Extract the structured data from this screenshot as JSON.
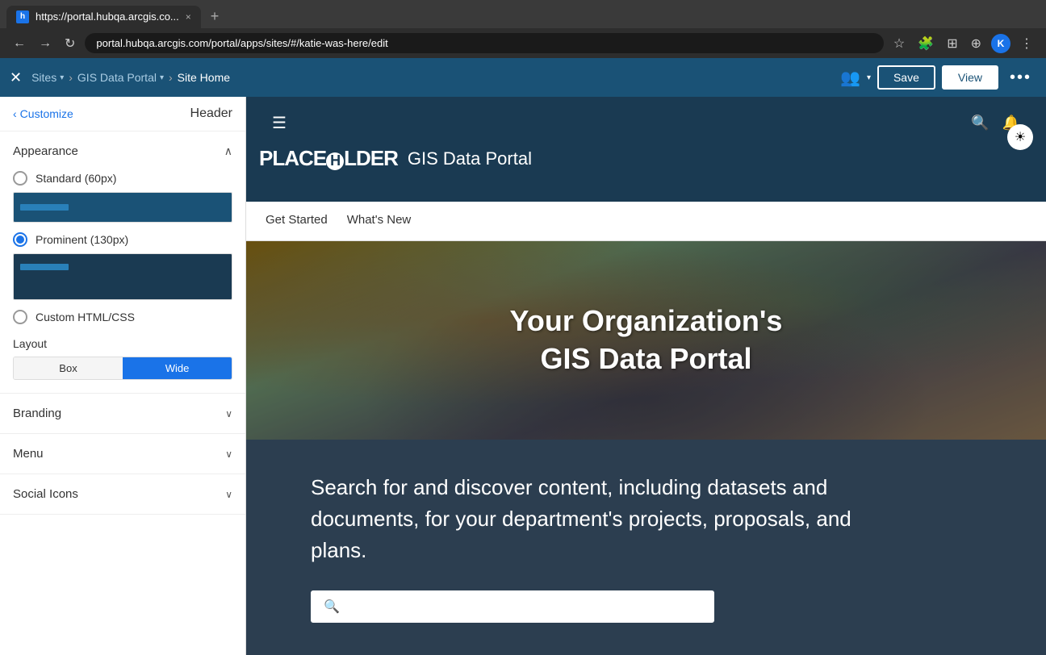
{
  "browser": {
    "tab_title": "https://portal.hubqa.arcgis.co...",
    "address": "portal.hubqa.arcgis.com/portal/apps/sites/#/katie-was-here/edit",
    "tab_close": "×",
    "tab_new": "+",
    "nav_back": "←",
    "nav_forward": "→",
    "nav_refresh": "↻",
    "profile_initial": "K"
  },
  "app_header": {
    "close_icon": "✕",
    "sites_label": "Sites",
    "gis_portal_label": "GIS Data Portal",
    "site_home_label": "Site Home",
    "save_label": "Save",
    "view_label": "View",
    "more_icon": "•••"
  },
  "panel": {
    "back_label": "Customize",
    "title": "Header",
    "appearance_title": "Appearance",
    "collapse_icon": "∧",
    "standard_label": "Standard (60px)",
    "prominent_label": "Prominent (130px)",
    "custom_html_label": "Custom HTML/CSS",
    "layout_title": "Layout",
    "layout_box": "Box",
    "layout_wide": "Wide",
    "branding_title": "Branding",
    "menu_title": "Menu",
    "social_icons_title": "Social Icons",
    "chevron_down": "∨"
  },
  "site": {
    "logo_text": "PLACEHLLDER",
    "site_name": "GIS Data Portal",
    "nav_items": [
      {
        "label": "Get Started",
        "active": false
      },
      {
        "label": "What's New",
        "active": false
      }
    ],
    "hero_title_line1": "Your Organization's",
    "hero_title_line2": "GIS Data Portal",
    "dark_section_text": "Search for and discover content, including datasets and documents, for your department's projects, proposals, and plans.",
    "search_placeholder": ""
  },
  "colors": {
    "app_header_bg": "#1a5276",
    "site_header_bg": "#1a3a52",
    "nav_bg": "#ffffff",
    "dark_section_bg": "#2c3e50",
    "accent": "#1a73e8"
  }
}
